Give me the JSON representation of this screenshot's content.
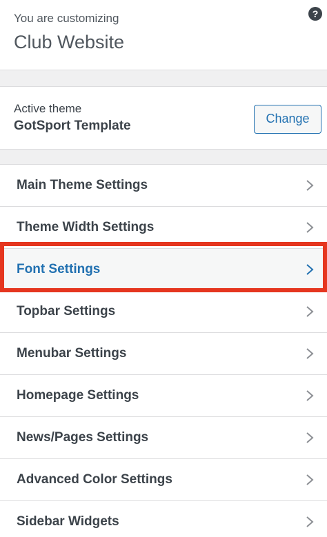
{
  "header": {
    "intro": "You are customizing",
    "site_title": "Club Website",
    "help_label": "?"
  },
  "theme": {
    "label": "Active theme",
    "name": "GotSport Template",
    "change_label": "Change"
  },
  "sections": {
    "items": [
      {
        "label": "Main Theme Settings"
      },
      {
        "label": "Theme Width Settings"
      },
      {
        "label": "Font Settings",
        "highlighted": true
      },
      {
        "label": "Topbar Settings"
      },
      {
        "label": "Menubar Settings"
      },
      {
        "label": "Homepage Settings"
      },
      {
        "label": "News/Pages Settings"
      },
      {
        "label": "Advanced Color Settings"
      },
      {
        "label": "Sidebar Widgets"
      }
    ]
  },
  "colors": {
    "accent": "#2271b1",
    "highlight_border": "#e5361f",
    "text": "#3c434a"
  },
  "icons": {
    "help": "question-mark-icon",
    "chevron": "chevron-right-icon"
  }
}
